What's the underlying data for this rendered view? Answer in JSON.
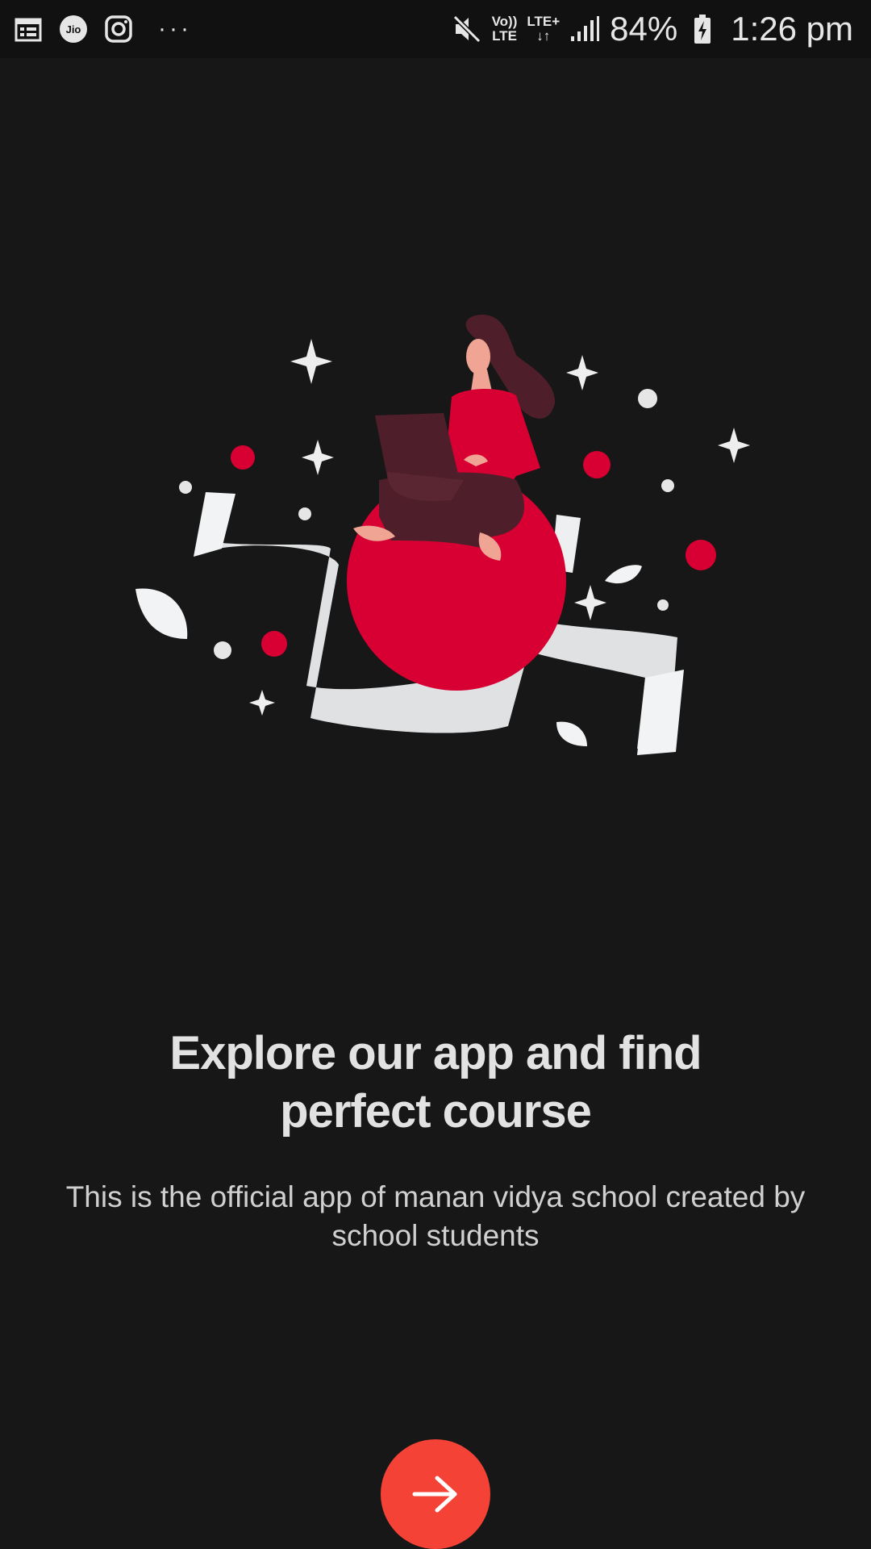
{
  "status_bar": {
    "left_icons": [
      "calendar-icon",
      "jio-icon",
      "instagram-icon"
    ],
    "more_notifications": "···",
    "volte_top": "Vo))",
    "volte_bottom": "LTE",
    "lte_top": "LTE+",
    "lte_bottom": "↓↑",
    "battery_percent": "84%",
    "time": "1:26 pm"
  },
  "onboarding": {
    "title_line1": "Explore our app and find",
    "title_line2": "perfect course",
    "subtitle_line1": "This is the official app of manan vidya school  created by",
    "subtitle_line2": "school students"
  },
  "next_button": {
    "icon": "arrow-right-icon",
    "color": "#f44336"
  },
  "colors": {
    "background": "#171717",
    "accent_red": "#d80033",
    "ribbon": "#dfe1e3",
    "dark_maroon": "#4e1f2a"
  }
}
